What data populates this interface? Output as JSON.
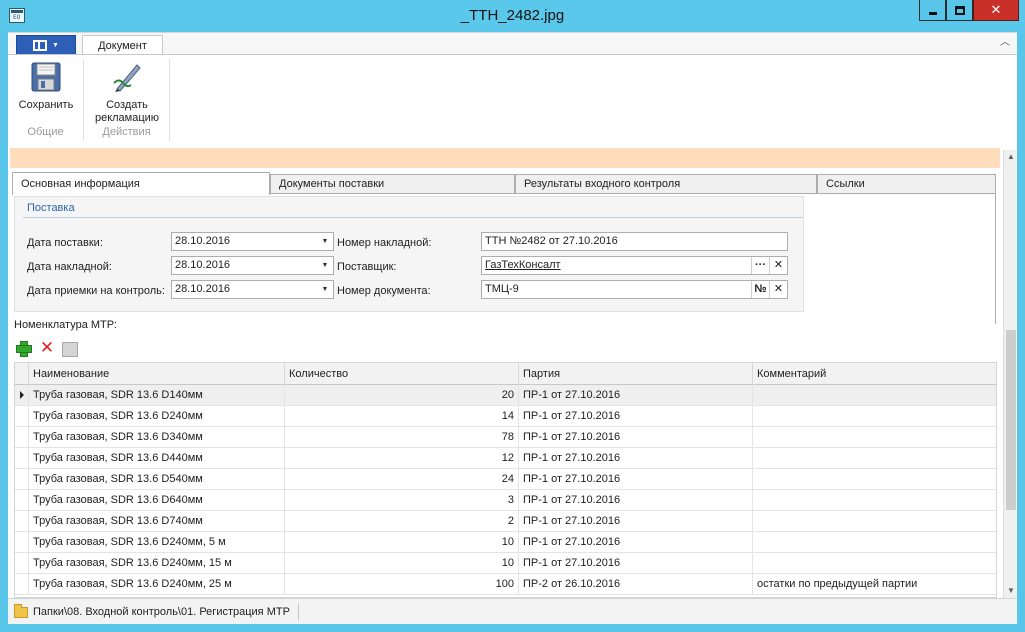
{
  "window": {
    "title": "_ТТН_2482.jpg"
  },
  "ribbon": {
    "tab": "Документ",
    "groups": [
      {
        "caption": "Общие",
        "buttons": [
          {
            "label": "Сохранить",
            "icon": "save-icon"
          }
        ]
      },
      {
        "caption": "Действия",
        "buttons": [
          {
            "label": "Создать\nрекламацию",
            "icon": "create-claim-icon"
          }
        ]
      }
    ]
  },
  "tabs": [
    {
      "label": "Основная информация",
      "active": true
    },
    {
      "label": "Документы поставки",
      "active": false
    },
    {
      "label": "Результаты входного контроля",
      "active": false
    },
    {
      "label": "Ссылки",
      "active": false
    }
  ],
  "delivery": {
    "group_title": "Поставка",
    "delivery_date_label": "Дата поставки:",
    "delivery_date": "28.10.2016",
    "invoice_date_label": "Дата накладной:",
    "invoice_date": "28.10.2016",
    "control_date_label": "Дата приемки на контроль:",
    "control_date": "28.10.2016",
    "invoice_number_label": "Номер накладной:",
    "invoice_number": "ТТН №2482 от 27.10.2016",
    "supplier_label": "Поставщик:",
    "supplier": "ГазТехКонсалт",
    "doc_number_label": "Номер документа:",
    "doc_number": "ТМЦ-9",
    "doc_number_button": "№"
  },
  "nomenclature": {
    "label": "Номенклатура МТР:",
    "columns": [
      "Наименование",
      "Количество",
      "Партия",
      "Комментарий"
    ],
    "rows": [
      {
        "name": "Труба газовая, SDR 13.6 D140мм",
        "qty": "20",
        "batch": "ПР-1 от 27.10.2016",
        "comment": ""
      },
      {
        "name": "Труба газовая, SDR 13.6 D240мм",
        "qty": "14",
        "batch": "ПР-1 от 27.10.2016",
        "comment": ""
      },
      {
        "name": "Труба газовая, SDR 13.6 D340мм",
        "qty": "78",
        "batch": "ПР-1 от 27.10.2016",
        "comment": ""
      },
      {
        "name": "Труба газовая, SDR 13.6 D440мм",
        "qty": "12",
        "batch": "ПР-1 от 27.10.2016",
        "comment": ""
      },
      {
        "name": "Труба газовая, SDR 13.6 D540мм",
        "qty": "24",
        "batch": "ПР-1 от 27.10.2016",
        "comment": ""
      },
      {
        "name": "Труба газовая, SDR 13.6 D640мм",
        "qty": "3",
        "batch": "ПР-1 от 27.10.2016",
        "comment": ""
      },
      {
        "name": "Труба газовая, SDR 13.6 D740мм",
        "qty": "2",
        "batch": "ПР-1 от 27.10.2016",
        "comment": ""
      },
      {
        "name": "Труба газовая, SDR 13.6 D240мм, 5 м",
        "qty": "10",
        "batch": "ПР-1 от 27.10.2016",
        "comment": ""
      },
      {
        "name": "Труба газовая, SDR 13.6 D240мм, 15 м",
        "qty": "10",
        "batch": "ПР-1 от 27.10.2016",
        "comment": ""
      },
      {
        "name": "Труба газовая, SDR 13.6 D240мм, 25 м",
        "qty": "100",
        "batch": "ПР-2 от 26.10.2016",
        "comment": "остатки по предыдущей партии"
      }
    ]
  },
  "statusbar": {
    "path": "Папки\\08. Входной контроль\\01. Регистрация МТР"
  },
  "colors": {
    "titlebar": "#5ac8ea",
    "close_button": "#c9302a",
    "app_menu": "#2e5fb8",
    "warning_bar": "#ffdcbc",
    "group_title": "#2d63ad"
  }
}
